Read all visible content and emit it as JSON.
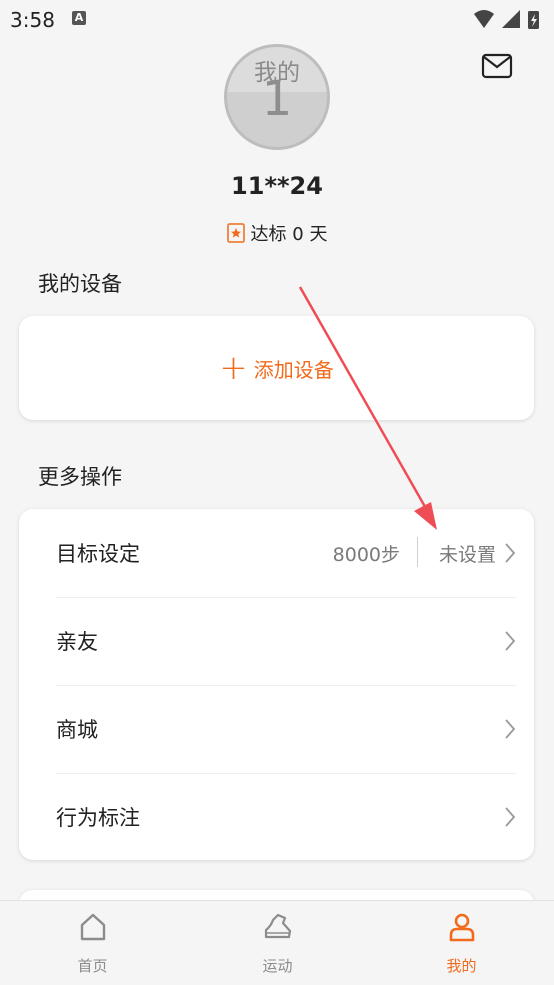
{
  "status_bar": {
    "time": "3:58",
    "notification_icon": "A"
  },
  "header": {
    "mail_icon": "envelope-icon"
  },
  "profile": {
    "avatar_text": "我的",
    "avatar_number": "1",
    "username": "11**24",
    "goal_label": "达标 0 天"
  },
  "devices": {
    "title": "我的设备",
    "add_label": "添加设备"
  },
  "more": {
    "title": "更多操作",
    "items": [
      {
        "label": "目标设定",
        "value": "8000步",
        "secondary": "未设置"
      },
      {
        "label": "亲友"
      },
      {
        "label": "商城"
      },
      {
        "label": "行为标注"
      }
    ]
  },
  "tabs": [
    {
      "label": "首页",
      "icon": "home-icon",
      "active": false
    },
    {
      "label": "运动",
      "icon": "shoe-icon",
      "active": false
    },
    {
      "label": "我的",
      "icon": "person-icon",
      "active": true
    }
  ],
  "colors": {
    "accent": "#f26b1d",
    "arrow": "#ef4d56"
  }
}
